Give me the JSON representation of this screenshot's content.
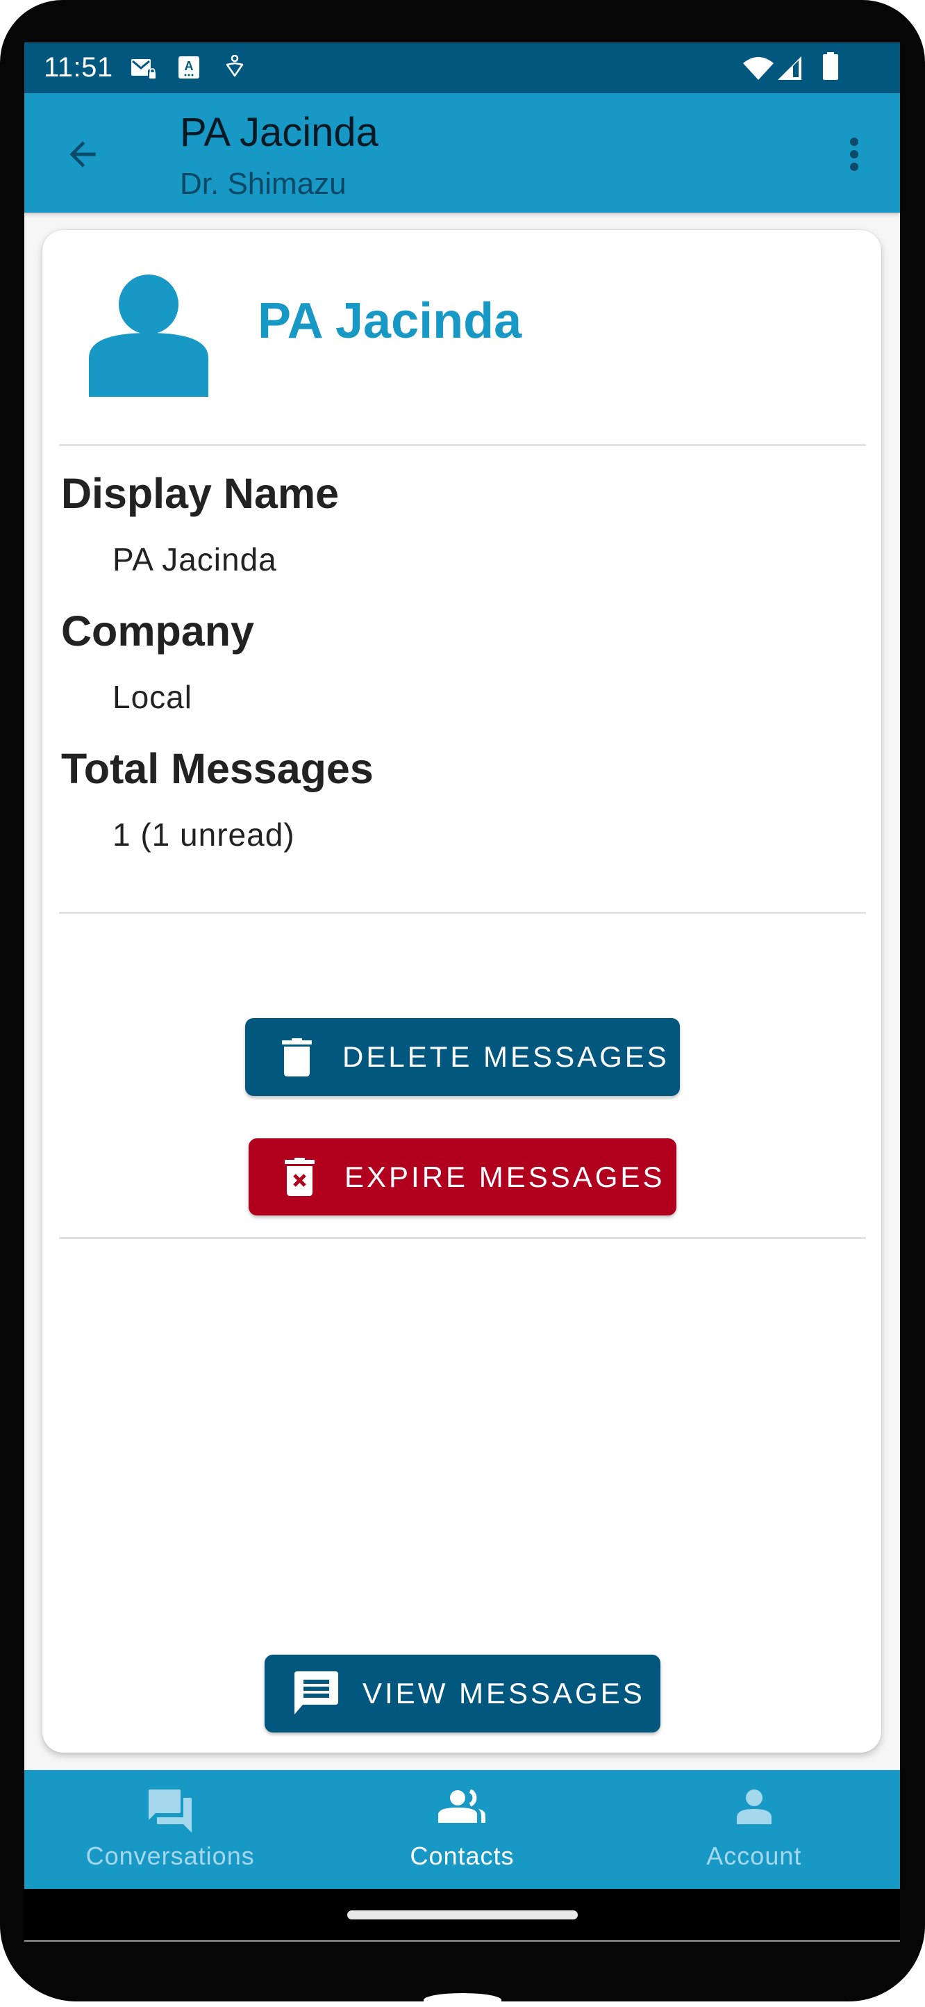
{
  "status_bar": {
    "time": "11:51",
    "left_icons": [
      "mail-lock-icon",
      "accessibility-a-icon",
      "accessibility-person-icon"
    ],
    "right_icons": [
      "wifi-icon",
      "cell-signal-icon",
      "battery-icon"
    ]
  },
  "app_bar": {
    "back_icon": "arrow-left-icon",
    "title": "PA Jacinda",
    "subtitle": "Dr. Shimazu",
    "overflow_icon": "more-vert-icon"
  },
  "profile": {
    "avatar_icon": "person-icon",
    "name": "PA Jacinda",
    "fields": [
      {
        "label": "Display Name",
        "value": "PA Jacinda"
      },
      {
        "label": "Company",
        "value": "Local"
      },
      {
        "label": "Total Messages",
        "value": "1 (1 unread)"
      }
    ]
  },
  "actions": {
    "delete": {
      "label": "DELETE MESSAGES",
      "icon": "trash-icon"
    },
    "expire": {
      "label": "EXPIRE MESSAGES",
      "icon": "trash-x-icon"
    },
    "view": {
      "label": "VIEW MESSAGES",
      "icon": "message-icon"
    }
  },
  "bottom_nav": {
    "items": [
      {
        "label": "Conversations",
        "icon": "forum-icon",
        "active": false
      },
      {
        "label": "Contacts",
        "icon": "people-icon",
        "active": true
      },
      {
        "label": "Account",
        "icon": "person-icon",
        "active": false
      }
    ]
  },
  "colors": {
    "status_bar": "#02577f",
    "app_bar": "#1898c5",
    "primary_button": "#02577f",
    "danger_button": "#b1001e",
    "accent_text": "#1898c5"
  }
}
